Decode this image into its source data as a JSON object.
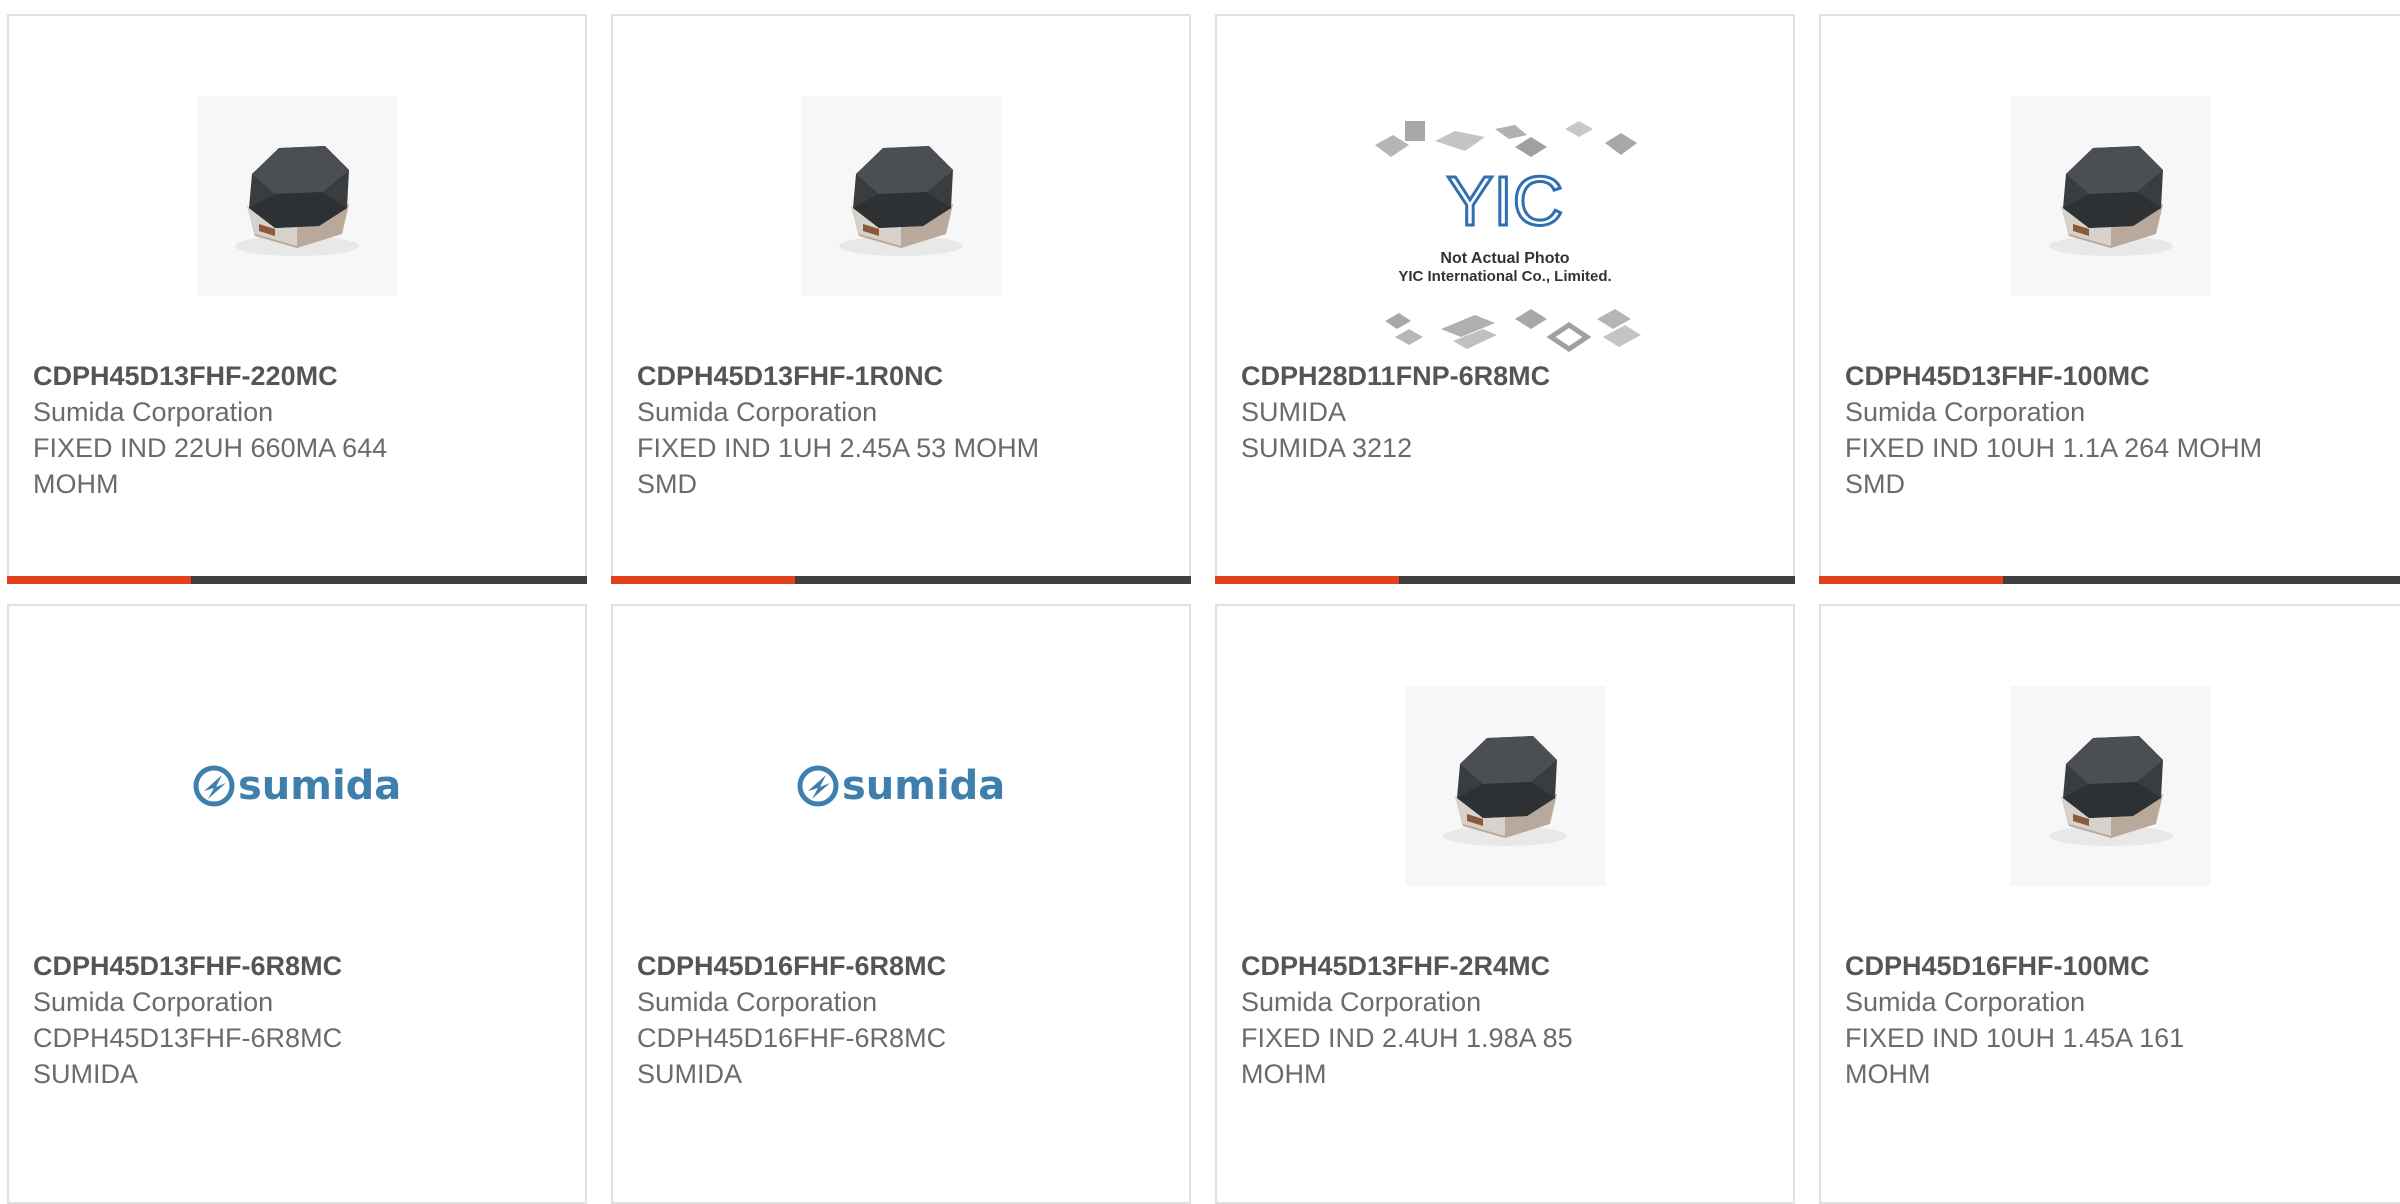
{
  "products": [
    {
      "part_number": "CDPH45D13FHF-220MC",
      "manufacturer": "Sumida Corporation",
      "description": "FIXED IND 22UH 660MA 644 MOHM",
      "image": "inductor-photo"
    },
    {
      "part_number": "CDPH45D13FHF-1R0NC",
      "manufacturer": "Sumida Corporation",
      "description": "FIXED IND 1UH 2.45A 53 MOHM SMD",
      "image": "inductor-photo"
    },
    {
      "part_number": "CDPH28D11FNP-6R8MC",
      "manufacturer": "SUMIDA",
      "description": "SUMIDA 3212",
      "image": "not-actual-photo-placeholder",
      "placeholder_text": {
        "brand": "YIC",
        "line1": "Not Actual Photo",
        "line2": "YIC International Co., Limited."
      }
    },
    {
      "part_number": "CDPH45D13FHF-100MC",
      "manufacturer": "Sumida Corporation",
      "description": "FIXED IND 10UH 1.1A 264 MOHM SMD",
      "image": "inductor-photo"
    },
    {
      "part_number": "CDPH45D13FHF-6R8MC",
      "manufacturer": "Sumida Corporation",
      "description": "CDPH45D13FHF-6R8MC SUMIDA",
      "image": "sumida-logo",
      "logo_text": "sumida"
    },
    {
      "part_number": "CDPH45D16FHF-6R8MC",
      "manufacturer": "Sumida Corporation",
      "description": "CDPH45D16FHF-6R8MC SUMIDA",
      "image": "sumida-logo",
      "logo_text": "sumida"
    },
    {
      "part_number": "CDPH45D13FHF-2R4MC",
      "manufacturer": "Sumida Corporation",
      "description": "FIXED IND 2.4UH 1.98A 85 MOHM",
      "image": "inductor-photo"
    },
    {
      "part_number": "CDPH45D16FHF-100MC",
      "manufacturer": "Sumida Corporation",
      "description": "FIXED IND 10UH 1.45A 161 MOHM",
      "image": "inductor-photo"
    }
  ],
  "colors": {
    "accent": "#e5401d",
    "bar_dark": "#3f3f3f",
    "logo_blue": "#3e7fae",
    "text": "#6b6b6b"
  }
}
